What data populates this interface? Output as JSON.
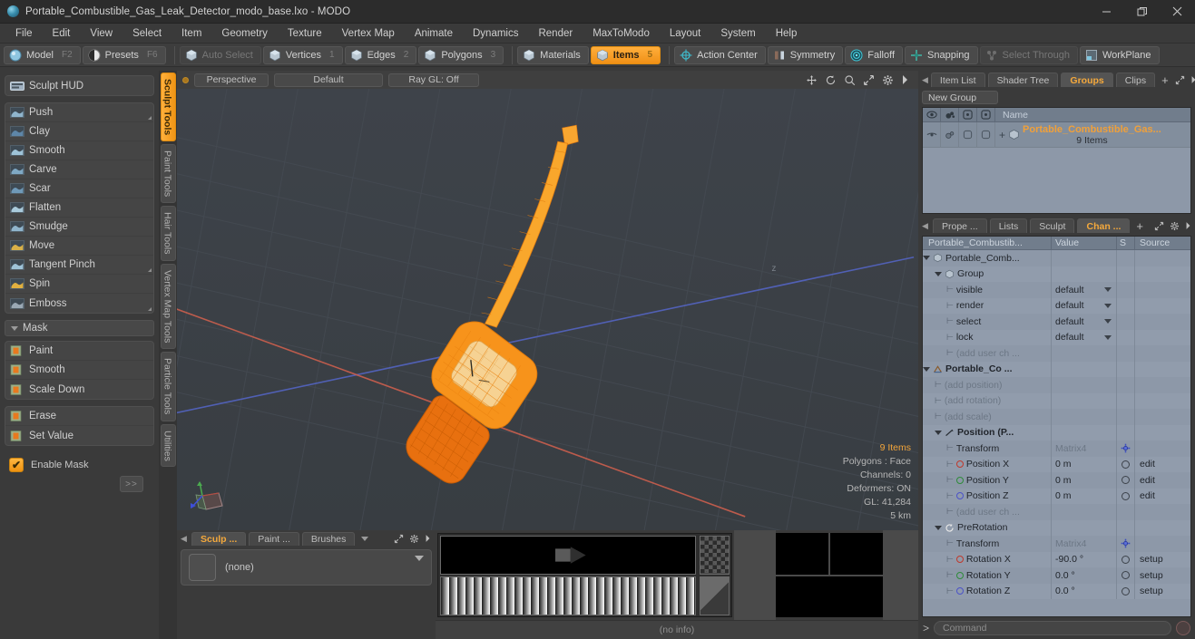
{
  "window": {
    "title": "Portable_Combustible_Gas_Leak_Detector_modo_base.lxo - MODO",
    "minimize": "—",
    "maximize": "❐",
    "close": "✕"
  },
  "menubar": {
    "items": [
      "File",
      "Edit",
      "View",
      "Select",
      "Item",
      "Geometry",
      "Texture",
      "Vertex Map",
      "Animate",
      "Dynamics",
      "Render",
      "MaxToModo",
      "Layout",
      "System",
      "Help"
    ]
  },
  "modebar": {
    "groups": [
      [
        {
          "label": "Model",
          "hint": "F2",
          "icon": "sphere-icon",
          "state": "normal"
        },
        {
          "label": "Presets",
          "hint": "F6",
          "icon": "half-sphere-icon",
          "state": "normal"
        }
      ],
      [
        {
          "label": "Auto Select",
          "hint": "",
          "icon": "cube-icon",
          "state": "dim"
        },
        {
          "label": "Vertices",
          "hint": "1",
          "icon": "cube-icon",
          "state": "normal"
        },
        {
          "label": "Edges",
          "hint": "2",
          "icon": "cube-icon",
          "state": "normal"
        },
        {
          "label": "Polygons",
          "hint": "3",
          "icon": "cube-icon",
          "state": "normal"
        }
      ],
      [
        {
          "label": "Materials",
          "hint": "",
          "icon": "cube-icon",
          "state": "normal"
        },
        {
          "label": "Items",
          "hint": "5",
          "icon": "cube-icon",
          "state": "active"
        }
      ],
      [
        {
          "label": "Action Center",
          "hint": "",
          "icon": "target-icon",
          "state": "normal"
        },
        {
          "label": "Symmetry",
          "hint": "",
          "icon": "symmetry-icon",
          "state": "normal"
        },
        {
          "label": "Falloff",
          "hint": "",
          "icon": "falloff-icon",
          "state": "normal"
        },
        {
          "label": "Snapping",
          "hint": "",
          "icon": "snap-icon",
          "state": "normal"
        },
        {
          "label": "Select Through",
          "hint": "",
          "icon": "select-through-icon",
          "state": "dim"
        },
        {
          "label": "WorkPlane",
          "hint": "",
          "icon": "workplane-icon",
          "state": "normal"
        }
      ]
    ]
  },
  "left_panel": {
    "hud_label": "Sculpt HUD",
    "sculpt_tools": [
      "Push",
      "Clay",
      "Smooth",
      "Carve",
      "Scar",
      "Flatten",
      "Smudge",
      "Move",
      "Tangent Pinch",
      "Spin",
      "Emboss"
    ],
    "mask_section": "Mask",
    "mask_tools": [
      "Paint",
      "Smooth",
      "Scale Down"
    ],
    "mask_tools2": [
      "Erase",
      "Set Value"
    ],
    "enable_mask": "Enable Mask",
    "more_label": ">>",
    "vertical_tabs": [
      "Sculpt Tools",
      "Paint Tools",
      "Hair Tools",
      "Vertex Map Tools",
      "Particle Tools",
      "Utilities"
    ],
    "active_vertical_tab": "Sculpt Tools"
  },
  "viewport": {
    "view_mode": "Perspective",
    "shading": "Default",
    "raygl": "Ray GL: Off",
    "info": {
      "items": "9 Items",
      "polygons": "Polygons : Face",
      "channels": "Channels: 0",
      "deformers": "Deformers: ON",
      "gl": "GL: 41,284",
      "scale": "5 km"
    },
    "toolbar_icons": [
      "move-icon",
      "rotate-icon",
      "zoom-icon",
      "expand-icon",
      "gear-icon",
      "chevron-right-icon"
    ],
    "model_color": "#f59a22",
    "background_color": "#3b4045",
    "axis_x_color": "#d4614e",
    "axis_z_color": "#5566c9"
  },
  "bottom_panel": {
    "tabs": [
      "Sculp ...",
      "Paint ...",
      "Brushes"
    ],
    "active_tab": "Sculp ...",
    "brush_value": "(none)",
    "no_info": "(no info)"
  },
  "right_panel": {
    "top_tabs": [
      "Item List",
      "Shader Tree",
      "Groups",
      "Clips"
    ],
    "top_active_tab": "Groups",
    "add_tab": "+",
    "new_group_label": "New Group",
    "list_columns": [
      "eye-icon",
      "render-icon",
      "select-icon",
      "lock-icon",
      "Name"
    ],
    "group_row": {
      "name": "Portable_Combustible_Gas...",
      "subtitle": "9 Items"
    },
    "bottom_tabs": [
      "Prope ...",
      "Lists",
      "Sculpt",
      "Chan ..."
    ],
    "bottom_active_tab": "Chan ...",
    "channel_columns": [
      "Portable_Combustib...",
      "Value",
      "S",
      "Source"
    ],
    "channel_rows": [
      {
        "indent": 0,
        "tri": true,
        "icon": "item-icon",
        "name": "Portable_Comb...",
        "value": "",
        "s": "",
        "source": "",
        "bold": false
      },
      {
        "indent": 1,
        "tri": true,
        "icon": "item-icon",
        "name": "Group",
        "value": "",
        "s": "",
        "source": "",
        "bold": false
      },
      {
        "indent": 2,
        "tri": false,
        "icon": "dash",
        "name": "visible",
        "value": "default",
        "dropdown": true,
        "s": "",
        "source": "",
        "bold": false
      },
      {
        "indent": 2,
        "tri": false,
        "icon": "dash",
        "name": "render",
        "value": "default",
        "dropdown": true,
        "s": "",
        "source": "",
        "bold": false
      },
      {
        "indent": 2,
        "tri": false,
        "icon": "dash",
        "name": "select",
        "value": "default",
        "dropdown": true,
        "s": "",
        "source": "",
        "bold": false
      },
      {
        "indent": 2,
        "tri": false,
        "icon": "dash",
        "name": "lock",
        "value": "default",
        "dropdown": true,
        "s": "",
        "source": "",
        "bold": false
      },
      {
        "indent": 2,
        "tri": false,
        "icon": "dash",
        "name": "(add user ch ...",
        "value": "",
        "s": "",
        "source": "",
        "dim": true
      },
      {
        "indent": 0,
        "tri": true,
        "icon": "locator-icon",
        "name": "Portable_Co ...",
        "value": "",
        "s": "",
        "source": "",
        "bold": true
      },
      {
        "indent": 1,
        "tri": false,
        "icon": "dash",
        "name": "(add position)",
        "value": "",
        "s": "",
        "source": "",
        "dim": true
      },
      {
        "indent": 1,
        "tri": false,
        "icon": "dash",
        "name": "(add rotation)",
        "value": "",
        "s": "",
        "source": "",
        "dim": true
      },
      {
        "indent": 1,
        "tri": false,
        "icon": "dash",
        "name": "(add scale)",
        "value": "",
        "s": "",
        "source": "",
        "dim": true
      },
      {
        "indent": 1,
        "tri": true,
        "icon": "position-icon",
        "name": "Position (P...",
        "value": "",
        "s": "",
        "source": "",
        "bold": true
      },
      {
        "indent": 2,
        "tri": false,
        "icon": "dash",
        "name": "Transform",
        "value": "Matrix4",
        "valueDim": true,
        "s": "gear",
        "source": "",
        "bold": false
      },
      {
        "indent": 2,
        "tri": false,
        "icon": "dash",
        "name": "Position X",
        "value": "0 m",
        "s": "circle",
        "source": "edit",
        "radio": "rx"
      },
      {
        "indent": 2,
        "tri": false,
        "icon": "dash",
        "name": "Position Y",
        "value": "0 m",
        "s": "circle",
        "source": "edit",
        "radio": "ry"
      },
      {
        "indent": 2,
        "tri": false,
        "icon": "dash",
        "name": "Position Z",
        "value": "0 m",
        "s": "circle",
        "source": "edit",
        "radio": "rz"
      },
      {
        "indent": 2,
        "tri": false,
        "icon": "dash",
        "name": "(add user ch ...",
        "value": "",
        "s": "",
        "source": "",
        "dim": true
      },
      {
        "indent": 1,
        "tri": true,
        "icon": "prerotation-icon",
        "name": "PreRotation",
        "value": "",
        "s": "",
        "source": "",
        "bold": false
      },
      {
        "indent": 2,
        "tri": false,
        "icon": "dash",
        "name": "Transform",
        "value": "Matrix4",
        "valueDim": true,
        "s": "gear",
        "source": "",
        "bold": false
      },
      {
        "indent": 2,
        "tri": false,
        "icon": "dash",
        "name": "Rotation X",
        "value": "-90.0 °",
        "s": "circle",
        "source": "setup",
        "radio": "rx"
      },
      {
        "indent": 2,
        "tri": false,
        "icon": "dash",
        "name": "Rotation Y",
        "value": "0.0 °",
        "s": "circle",
        "source": "setup",
        "radio": "ry"
      },
      {
        "indent": 2,
        "tri": false,
        "icon": "dash",
        "name": "Rotation Z",
        "value": "0.0 °",
        "s": "circle",
        "source": "setup",
        "radio": "rz"
      }
    ]
  },
  "command_bar": {
    "prompt": ">",
    "placeholder": "Command",
    "record_icon": "record-icon"
  }
}
